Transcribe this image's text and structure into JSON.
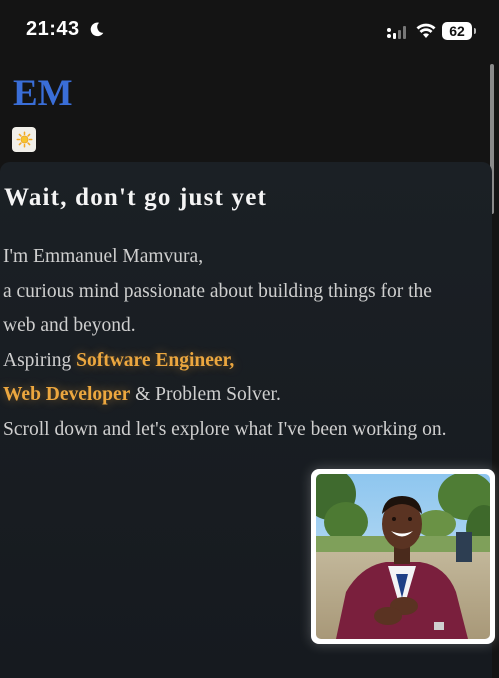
{
  "status_bar": {
    "time": "21:43",
    "battery": "62",
    "icons": [
      "moon-icon",
      "signal-icon",
      "wifi-icon",
      "battery-icon"
    ]
  },
  "header": {
    "logo": "EM",
    "theme_toggle_icon": "sun-icon"
  },
  "hero": {
    "title": "Wait, don't go just yet",
    "line1": "I'm Emmanuel Mamvura,",
    "line2": "a curious mind passionate about building things for the",
    "line3": "web and beyond.",
    "line4_prefix": "Aspiring ",
    "role1": "Software Engineer,",
    "role2": "Web Developer",
    "line5_suffix": " & Problem Solver.",
    "line6": "Scroll down and let's explore what I've been working on."
  },
  "profile": {
    "photo_alt": "Profile photo"
  },
  "colors": {
    "background": "#141414",
    "logo": "#3a6ed8",
    "accent": "#eca73f",
    "text": "#cfcfcf"
  }
}
